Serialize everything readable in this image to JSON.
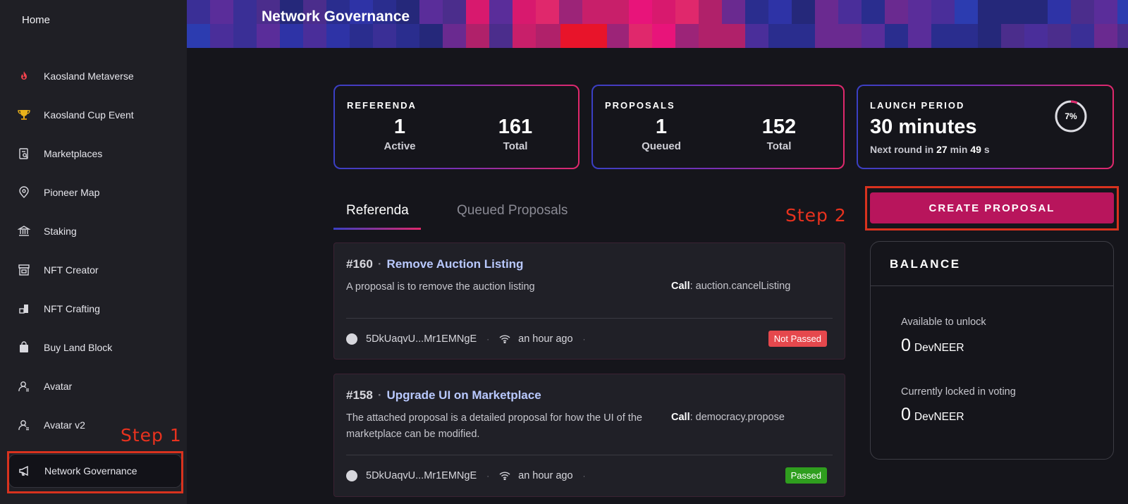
{
  "sidebar": {
    "home_label": "Home",
    "items": [
      {
        "label": "Kaosland Metaverse",
        "icon": "flame-icon"
      },
      {
        "label": "Kaosland Cup Event",
        "icon": "trophy-icon"
      },
      {
        "label": "Marketplaces",
        "icon": "marketplace-icon"
      },
      {
        "label": "Pioneer Map",
        "icon": "map-pin-icon"
      },
      {
        "label": "Staking",
        "icon": "bank-icon"
      },
      {
        "label": "NFT Creator",
        "icon": "store-icon"
      },
      {
        "label": "NFT Crafting",
        "icon": "blocks-icon"
      },
      {
        "label": "Buy Land Block",
        "icon": "shopping-bag-icon"
      },
      {
        "label": "Avatar",
        "icon": "user-icon"
      },
      {
        "label": "Avatar v2",
        "icon": "user-icon"
      },
      {
        "label": "Network Governance",
        "icon": "megaphone-icon",
        "active": true
      }
    ]
  },
  "annotations": {
    "step1": "Step 1",
    "step2": "Step 2",
    "highlight_color": "#d8321e"
  },
  "header": {
    "title": "Network Governance"
  },
  "stats": {
    "referenda": {
      "heading": "REFERENDA",
      "active_value": "1",
      "active_label": "Active",
      "total_value": "161",
      "total_label": "Total"
    },
    "proposals": {
      "heading": "PROPOSALS",
      "queued_value": "1",
      "queued_label": "Queued",
      "total_value": "152",
      "total_label": "Total"
    },
    "launch_period": {
      "heading": "LAUNCH PERIOD",
      "value": "30 minutes",
      "next_prefix": "Next round in",
      "next_minutes": "27",
      "min_unit": "min",
      "next_seconds": "49",
      "sec_unit": "s",
      "progress_label": "7%",
      "progress_fraction": 0.07
    }
  },
  "tabs": [
    {
      "label": "Referenda",
      "active": true
    },
    {
      "label": "Queued Proposals",
      "active": false
    }
  ],
  "create_proposal_label": "CREATE PROPOSAL",
  "referenda": [
    {
      "number": "#160",
      "title": "Remove Auction Listing",
      "description": "A proposal is to remove the auction listing",
      "call_label": "Call",
      "call_value": "auction.cancelListing",
      "author": "5DkUaqvU...Mr1EMNgE",
      "time": "an hour ago",
      "status": "Not Passed",
      "status_color": "#e5484d"
    },
    {
      "number": "#158",
      "title": "Upgrade UI on Marketplace",
      "description": "The attached proposal is a detailed proposal for how the UI of the marketplace can be modified.",
      "call_label": "Call",
      "call_value": "democracy.propose",
      "author": "5DkUaqvU...Mr1EMNgE",
      "time": "an hour ago",
      "status": "Passed",
      "status_color": "#2f9e1e"
    }
  ],
  "balance": {
    "title": "BALANCE",
    "available_label": "Available to unlock",
    "available_value": "0",
    "available_unit": "DevNEER",
    "locked_label": "Currently locked in voting",
    "locked_value": "0",
    "locked_unit": "DevNEER"
  },
  "colors": {
    "accent": "#b8155c",
    "link": "#b9c9ff",
    "background": "#15151b",
    "sidebar": "#1f1f25"
  }
}
